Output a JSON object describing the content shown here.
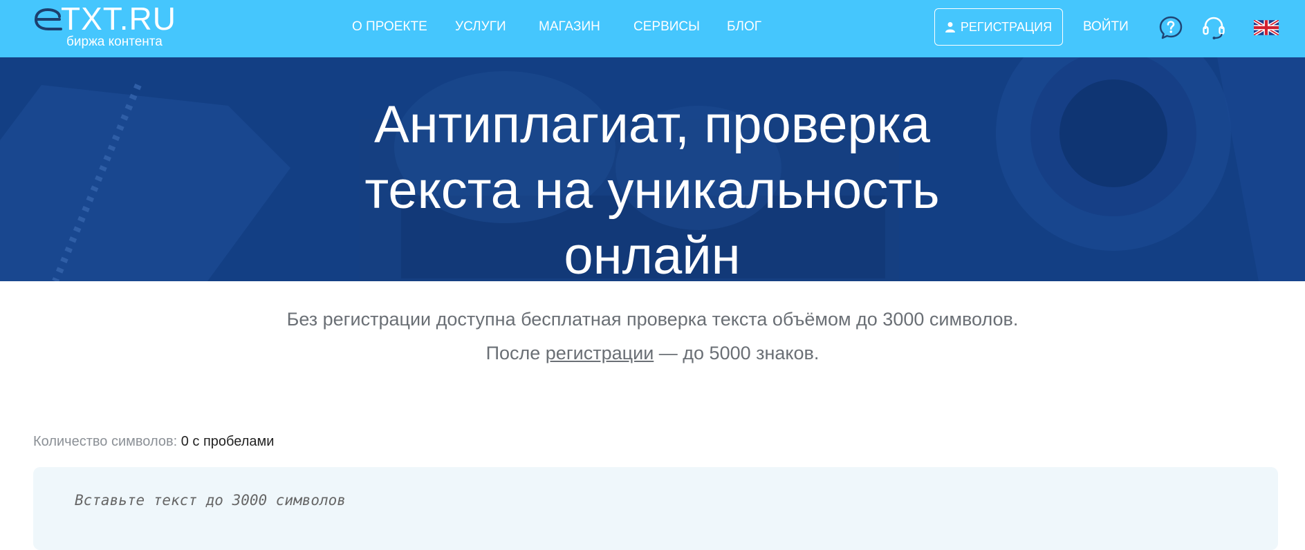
{
  "header": {
    "logo_text": "TXT.RU",
    "logo_sub": "биржа контента",
    "nav": [
      {
        "label": "О проекте"
      },
      {
        "label": "Услуги"
      },
      {
        "label": "Магазин"
      },
      {
        "label": "Сервисы"
      },
      {
        "label": "Блог"
      }
    ],
    "register_label": "Регистрация",
    "login_label": "Войти",
    "icons": [
      "user-icon",
      "help-icon",
      "support-headset-icon",
      "uk-flag-icon"
    ]
  },
  "hero": {
    "title_lines": [
      "Антиплагиат, проверка",
      "текста на уникальность",
      "онлайн"
    ]
  },
  "info": {
    "line1": "Без регистрации доступна бесплатная проверка текста объёмом до 3000 символов.",
    "line2_prefix": "После ",
    "line2_link": "регистрации",
    "line2_suffix": " — до 5000 знаков."
  },
  "counter": {
    "label": "Количество символов:",
    "value": "0 с пробелами"
  },
  "editor": {
    "placeholder": "Вставьте текст до 3000 символов"
  },
  "colors": {
    "header_bg": "#45c6fd",
    "hero_bg": "#123e82",
    "editor_bg": "#eff7fb"
  }
}
